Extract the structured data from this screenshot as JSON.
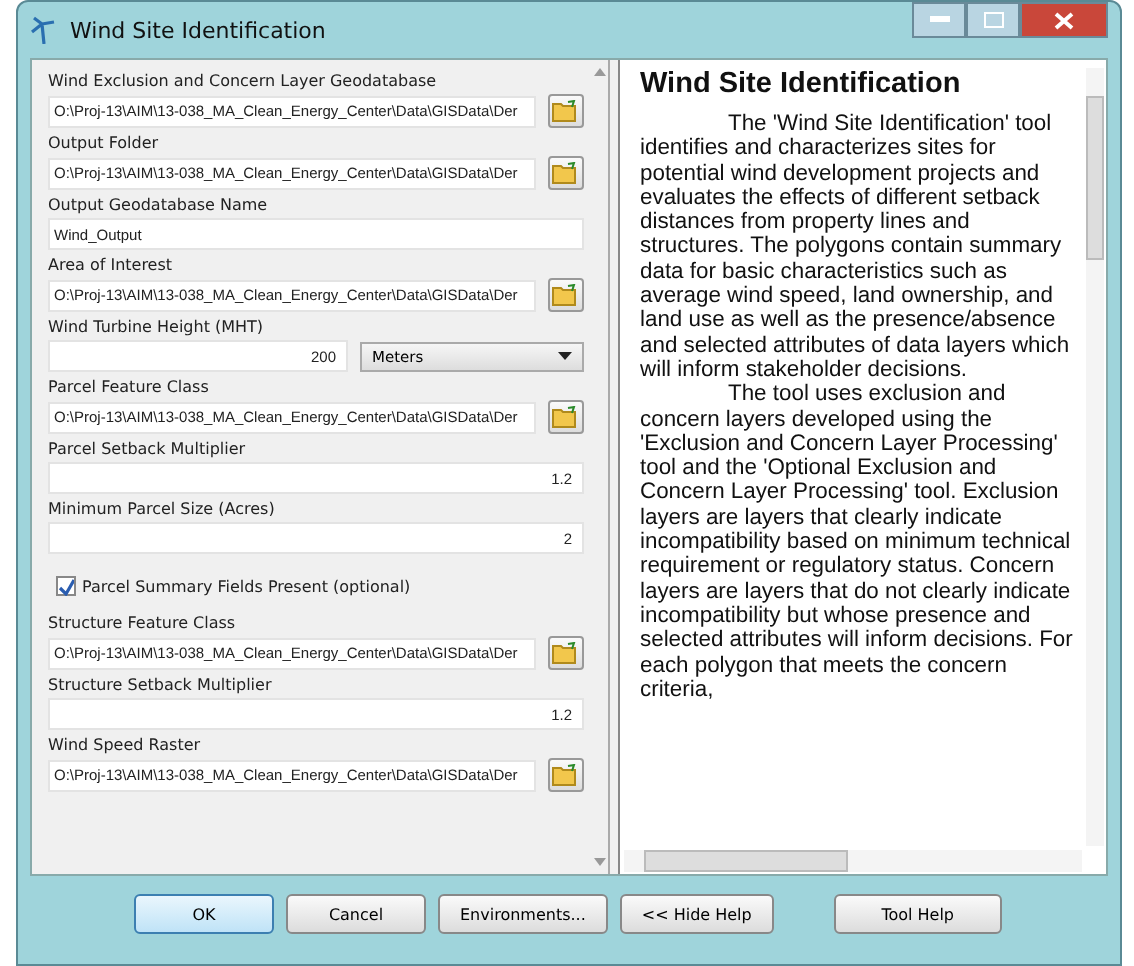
{
  "window": {
    "title": "Wind Site Identification"
  },
  "fields": [
    {
      "kind": "path",
      "label": "Wind Exclusion and Concern Layer Geodatabase",
      "value": "O:\\Proj-13\\AIM\\13-038_MA_Clean_Energy_Center\\Data\\GISData\\Der"
    },
    {
      "kind": "path",
      "label": "Output Folder",
      "value": "O:\\Proj-13\\AIM\\13-038_MA_Clean_Energy_Center\\Data\\GISData\\Der"
    },
    {
      "kind": "text",
      "label": "Output Geodatabase Name",
      "value": "Wind_Output"
    },
    {
      "kind": "path",
      "label": "Area of Interest",
      "value": "O:\\Proj-13\\AIM\\13-038_MA_Clean_Energy_Center\\Data\\GISData\\Der"
    },
    {
      "kind": "units",
      "label": "Wind Turbine Height (MHT)",
      "value": "200",
      "unit": "Meters"
    },
    {
      "kind": "path",
      "label": "Parcel Feature Class",
      "value": "O:\\Proj-13\\AIM\\13-038_MA_Clean_Energy_Center\\Data\\GISData\\Der"
    },
    {
      "kind": "number",
      "label": "Parcel Setback Multiplier",
      "value": "1.2"
    },
    {
      "kind": "number",
      "label": "Minimum Parcel Size (Acres)",
      "value": "2"
    },
    {
      "kind": "checkbox",
      "label": "Parcel Summary Fields Present (optional)",
      "checked": true
    },
    {
      "kind": "path",
      "label": "Structure Feature Class",
      "value": "O:\\Proj-13\\AIM\\13-038_MA_Clean_Energy_Center\\Data\\GISData\\Der"
    },
    {
      "kind": "number",
      "label": "Structure Setback Multiplier",
      "value": "1.2"
    },
    {
      "kind": "path",
      "label": "Wind Speed Raster",
      "value": "O:\\Proj-13\\AIM\\13-038_MA_Clean_Energy_Center\\Data\\GISData\\Der"
    }
  ],
  "help": {
    "title": "Wind Site Identification",
    "paragraphs": [
      "The 'Wind Site Identification' tool identifies and characterizes sites for potential wind development projects and evaluates the effects of different setback distances from property lines and structures. The polygons contain summary data for basic characteristics such as average wind speed, land ownership, and land use as well as the presence/absence and selected attributes of data layers which will inform stakeholder decisions.",
      "The tool uses exclusion and concern layers developed using the 'Exclusion and Concern Layer Processing' tool and the 'Optional Exclusion and Concern Layer Processing' tool. Exclusion layers are layers that clearly indicate incompatibility based on minimum technical requirement or regulatory status. Concern layers are layers that do not clearly indicate incompatibility but whose presence and selected attributes will inform decisions. For each polygon that meets the concern criteria,"
    ]
  },
  "buttons": [
    {
      "label": "OK",
      "selected": true
    },
    {
      "label": "Cancel",
      "selected": false
    },
    {
      "label": "Environments...",
      "selected": false
    },
    {
      "label": "<< Hide Help",
      "selected": false
    }
  ],
  "help_button": "Tool Help"
}
